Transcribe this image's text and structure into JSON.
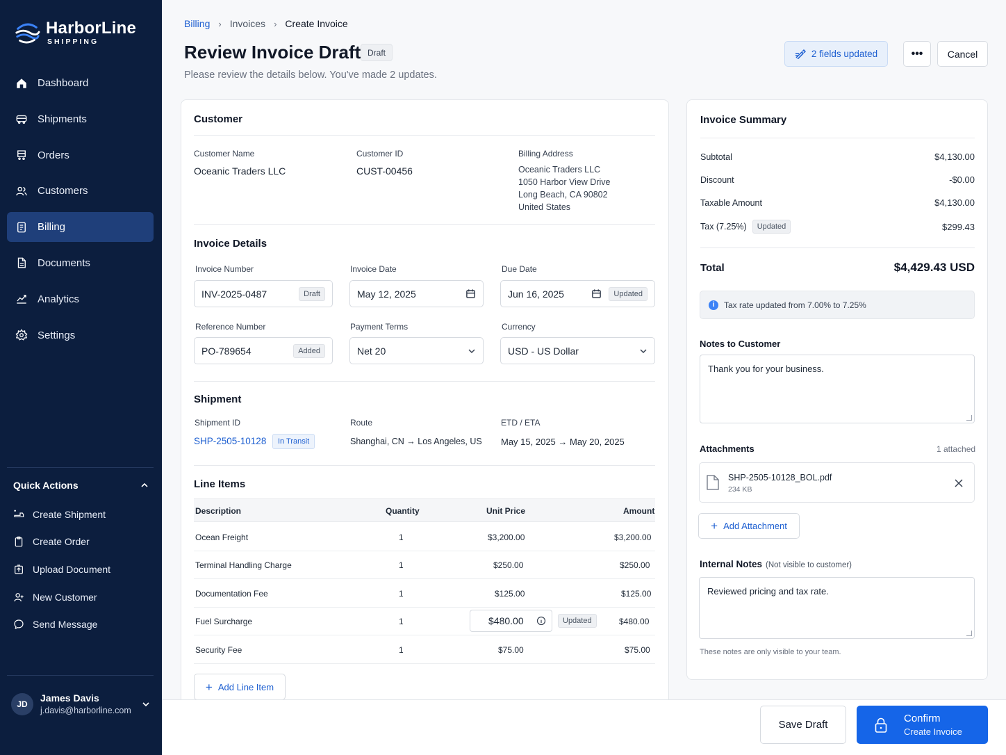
{
  "brand": {
    "name": "HarborLine",
    "sub": "SHIPPING"
  },
  "nav": [
    {
      "label": "Dashboard",
      "icon": "home-icon"
    },
    {
      "label": "Shipments",
      "icon": "truck-icon"
    },
    {
      "label": "Orders",
      "icon": "cart-icon"
    },
    {
      "label": "Customers",
      "icon": "users-icon"
    },
    {
      "label": "Billing",
      "icon": "billing-icon",
      "active": true
    },
    {
      "label": "Documents",
      "icon": "document-icon"
    },
    {
      "label": "Analytics",
      "icon": "chart-icon"
    },
    {
      "label": "Settings",
      "icon": "gear-icon"
    }
  ],
  "quick_actions": {
    "title": "Quick Actions",
    "items": [
      {
        "label": "Create Shipment",
        "icon": "plus-truck-icon"
      },
      {
        "label": "Create Order",
        "icon": "clipboard-icon"
      },
      {
        "label": "Upload Document",
        "icon": "upload-icon"
      },
      {
        "label": "New Customer",
        "icon": "user-add-icon"
      },
      {
        "label": "Send Message",
        "icon": "message-icon"
      }
    ]
  },
  "user": {
    "initials": "JD",
    "name": "James Davis",
    "email": "j.davis@harborline.com"
  },
  "breadcrumb": {
    "b1": "Billing",
    "b2": "Invoices",
    "b3": "Create Invoice"
  },
  "header": {
    "title": "Review Invoice Draft",
    "badge": "Draft",
    "subtitle": "Please review the details below. You've made 2 updates.",
    "updated_label": "2 fields updated",
    "more_label": "•••",
    "cancel_label": "Cancel"
  },
  "customer": {
    "section": "Customer",
    "name_label": "Customer Name",
    "name": "Oceanic Traders LLC",
    "id_label": "Customer ID",
    "id": "CUST-00456",
    "address_label": "Billing Address",
    "address": [
      "Oceanic Traders LLC",
      "1050 Harbor View Drive",
      "Long Beach, CA 90802",
      "United States"
    ]
  },
  "invoice": {
    "section": "Invoice Details",
    "number_label": "Invoice Number",
    "number": "INV-2025-0487",
    "number_chip": "Draft",
    "date_label": "Invoice Date",
    "date": "May 12, 2025",
    "due_label": "Due Date",
    "due": "Jun 16, 2025",
    "due_chip": "Updated",
    "ref_label": "Reference Number",
    "ref": "PO-789654",
    "ref_chip": "Added",
    "terms_label": "Payment Terms",
    "terms": "Net 20",
    "currency_label": "Currency",
    "currency": "USD - US Dollar"
  },
  "shipment": {
    "section": "Shipment",
    "id_label": "Shipment ID",
    "id": "SHP-2505-10128",
    "status": "In Transit",
    "route_label": "Route",
    "route": "Shanghai, CN → Los Angeles, US",
    "eta_label": "ETD / ETA",
    "eta": "May 15, 2025 → May 20, 2025"
  },
  "line_items": {
    "section": "Line Items",
    "headers": {
      "desc": "Description",
      "qty": "Quantity",
      "unit": "Unit Price",
      "amount": "Amount"
    },
    "rows": [
      {
        "desc": "Ocean Freight",
        "qty": "1",
        "unit": "$3,200.00",
        "amount": "$3,200.00"
      },
      {
        "desc": "Terminal Handling Charge",
        "qty": "1",
        "unit": "$250.00",
        "amount": "$250.00"
      },
      {
        "desc": "Documentation Fee",
        "qty": "1",
        "unit": "$125.00",
        "amount": "$125.00"
      },
      {
        "desc": "Fuel Surcharge",
        "qty": "1",
        "unit": "$480.00",
        "amount": "$480.00",
        "chip": "Updated"
      },
      {
        "desc": "Security Fee",
        "qty": "1",
        "unit": "$75.00",
        "amount": "$75.00"
      }
    ],
    "add_label": "Add Line Item"
  },
  "summary": {
    "title": "Invoice Summary",
    "subtotal_label": "Subtotal",
    "subtotal": "$4,130.00",
    "discount_label": "Discount",
    "discount": "-$0.00",
    "taxable_label": "Taxable Amount",
    "taxable": "$4,130.00",
    "tax_label": "Tax (7.25%)",
    "tax_chip": "Updated",
    "tax": "$299.43",
    "total_label": "Total",
    "total": "$4,429.43 USD",
    "info": "Tax rate updated from 7.00% to 7.25%",
    "notes_label": "Notes to Customer",
    "notes": "Thank you for your business.",
    "attachments_label": "Attachments",
    "attachments_count": "1 attached",
    "file_name": "SHP-2505-10128_BOL.pdf",
    "file_size": "234 KB",
    "add_attachment": "Add Attachment",
    "internal_label": "Internal Notes",
    "internal_hint": "(Not visible to customer)",
    "internal_notes": "Reviewed pricing and tax rate.",
    "internal_help": "These notes are only visible to your team."
  },
  "footer": {
    "save": "Save Draft",
    "confirm": "Confirm",
    "confirm_sub": "Create Invoice"
  },
  "colors": {
    "sidebar": "#0c1e3e",
    "accent": "#1565e8",
    "active_nav": "#1f3f7a"
  }
}
